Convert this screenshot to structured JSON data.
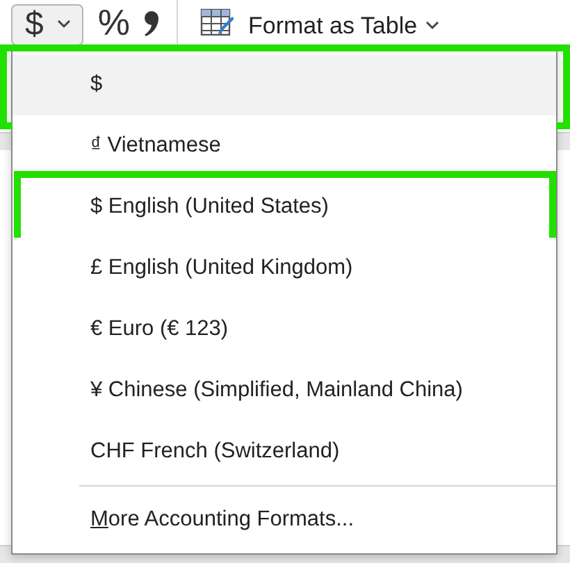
{
  "toolbar": {
    "currency_button": {
      "symbol": "$",
      "pressed": true
    },
    "percent_button": {
      "symbol": "%"
    },
    "format_as_table": {
      "label": "Format as Table"
    }
  },
  "menu": {
    "items": [
      {
        "kind": "option",
        "label": "$",
        "hovered": true,
        "highlighted": true
      },
      {
        "kind": "option",
        "label": "₫ Vietnamese",
        "hovered": false,
        "highlighted": false
      },
      {
        "kind": "option",
        "label": "$ English (United States)",
        "hovered": false,
        "highlighted": true
      },
      {
        "kind": "option",
        "label": "£ English (United Kingdom)",
        "hovered": false,
        "highlighted": false
      },
      {
        "kind": "option",
        "label": "€ Euro (€ 123)",
        "hovered": false,
        "highlighted": false
      },
      {
        "kind": "option",
        "label": "¥ Chinese (Simplified, Mainland China)",
        "hovered": false,
        "highlighted": false
      },
      {
        "kind": "option",
        "label": "CHF French (Switzerland)",
        "hovered": false,
        "highlighted": false
      },
      {
        "kind": "divider"
      },
      {
        "kind": "command",
        "label": "More Accounting Formats...",
        "underline_first": true,
        "hovered": false,
        "highlighted": false
      }
    ]
  }
}
